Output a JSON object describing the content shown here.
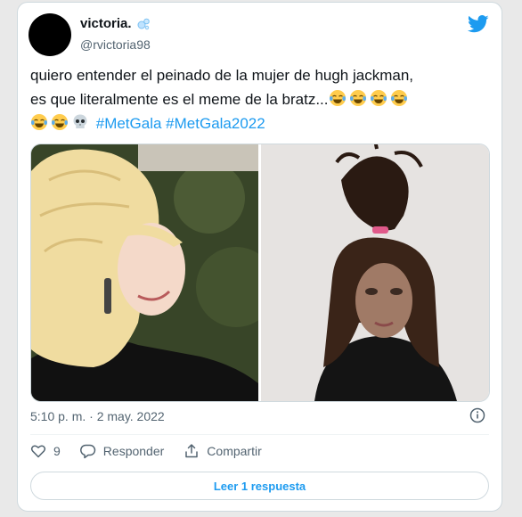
{
  "tweet": {
    "display_name": "victoria.",
    "handle": "@rvictoria98",
    "text_line1": "quiero entender el peinado de la mujer de hugh jackman,",
    "text_line2": "es que literalmente es el meme de la bratz...",
    "hashtag1": "#MetGala",
    "hashtag2": "#MetGala2022",
    "timestamp": "5:10 p. m. · 2 may. 2022",
    "likes": "9",
    "reply_label": "Responder",
    "share_label": "Compartir",
    "read_replies_label": "Leer 1 respuesta"
  },
  "colors": {
    "accent": "#1d9bf0",
    "text": "#0f1419",
    "muted": "#536471",
    "border": "#cfd9de"
  },
  "icons": {
    "verified_badge": "bubbles-icon",
    "brand": "twitter-bird-icon",
    "emoji_laugh": "face-with-tears-of-joy-icon",
    "emoji_skull": "skull-icon",
    "info": "info-icon",
    "like": "heart-icon",
    "reply": "reply-icon",
    "share": "share-icon"
  }
}
